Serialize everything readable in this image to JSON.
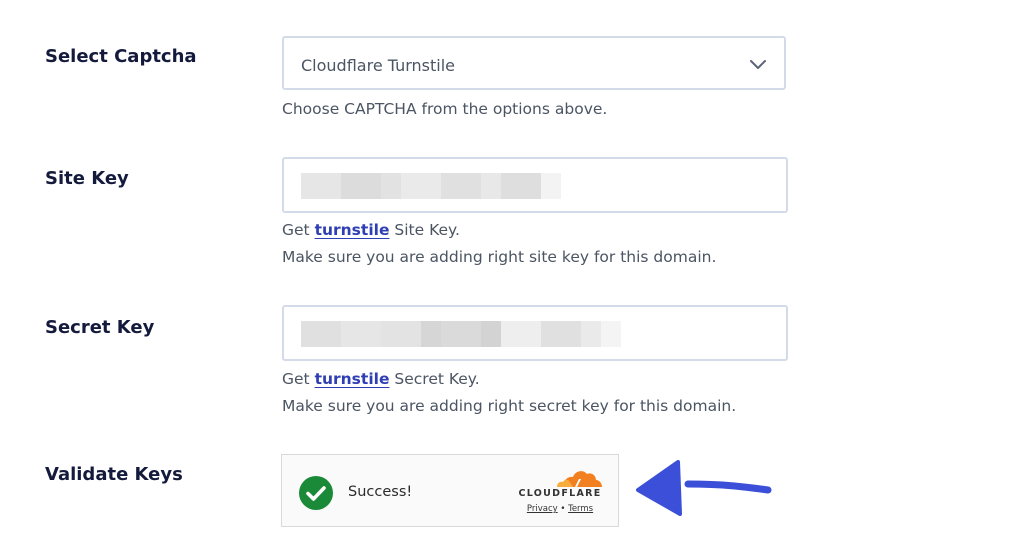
{
  "select_captcha": {
    "label": "Select Captcha",
    "value": "Cloudflare Turnstile",
    "help": "Choose CAPTCHA from the options above."
  },
  "site_key": {
    "label": "Site Key",
    "help_prefix": "Get ",
    "help_link": "turnstile",
    "help_suffix": " Site Key.",
    "help_line2": "Make sure you are adding right site key for this domain."
  },
  "secret_key": {
    "label": "Secret Key",
    "help_prefix": "Get ",
    "help_link": "turnstile",
    "help_suffix": " Secret Key.",
    "help_line2": "Make sure you are adding right secret key for this domain."
  },
  "validate_keys": {
    "label": "Validate Keys",
    "widget": {
      "status_text": "Success!",
      "brand": "CLOUDFLARE",
      "privacy": "Privacy",
      "separator": "•",
      "terms": "Terms"
    }
  },
  "colors": {
    "success_green": "#1a8a38",
    "cloudflare_orange": "#f38020",
    "link_blue": "#2f3fb3",
    "arrow_blue": "#3b4fd8"
  },
  "icons": {
    "select_chevron": "chevron-down-icon",
    "status": "check-circle-icon",
    "brand": "cloudflare-cloud-icon",
    "annotation": "arrow-left-icon"
  }
}
